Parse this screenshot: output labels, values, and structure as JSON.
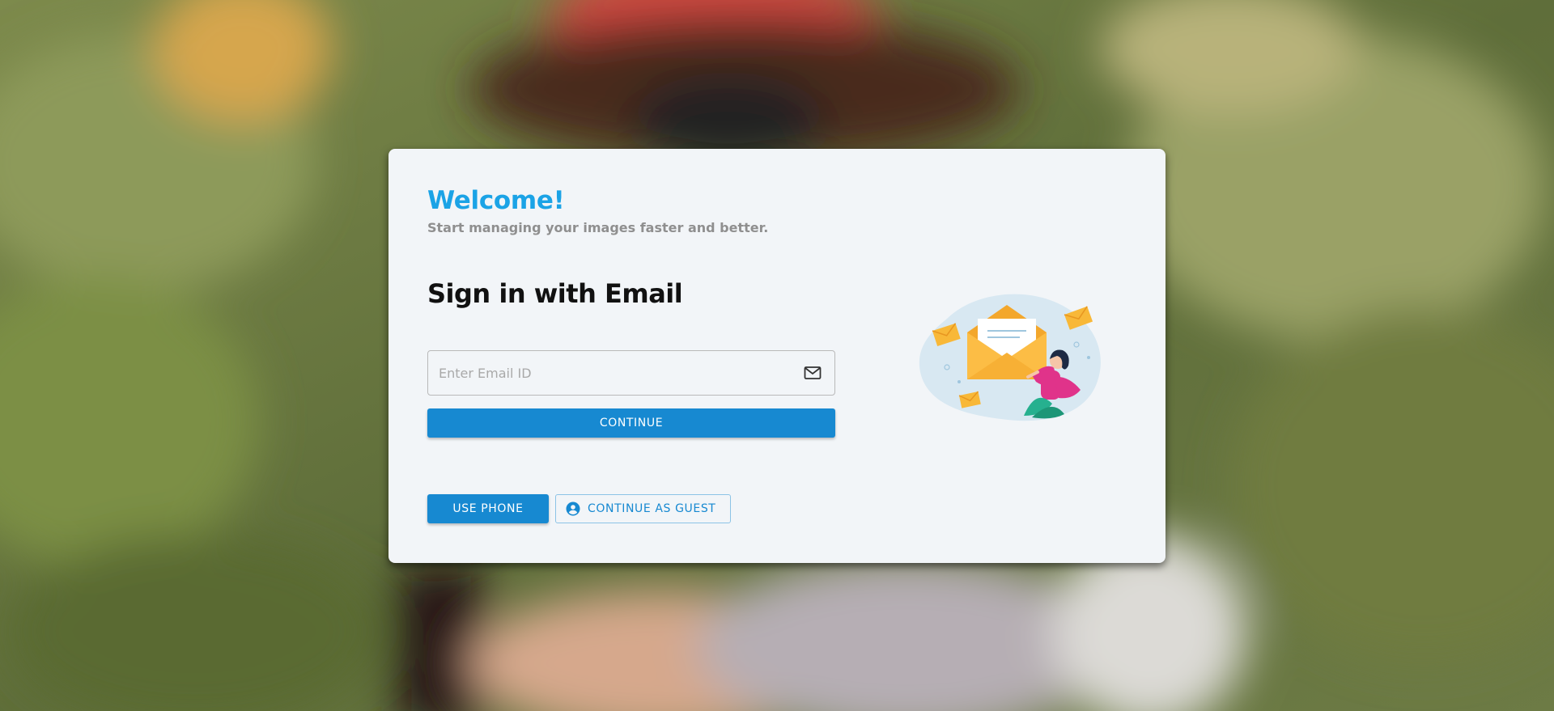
{
  "header": {
    "welcome": "Welcome!",
    "subtitle": "Start managing your images faster and better."
  },
  "signin": {
    "heading": "Sign in with Email",
    "email_placeholder": "Enter Email ID",
    "email_value": "",
    "continue_label": "CONTINUE"
  },
  "alternatives": {
    "phone_label": "USE PHONE",
    "guest_label": "CONTINUE AS GUEST"
  },
  "icons": {
    "email_field": "mail-icon",
    "guest_button": "account-circle-icon",
    "illustration": "email-illustration"
  },
  "colors": {
    "accent": "#1789d1",
    "welcome": "#1ba3e6",
    "card_background": "#f2f5f8",
    "subtitle": "#8f8f8f"
  }
}
